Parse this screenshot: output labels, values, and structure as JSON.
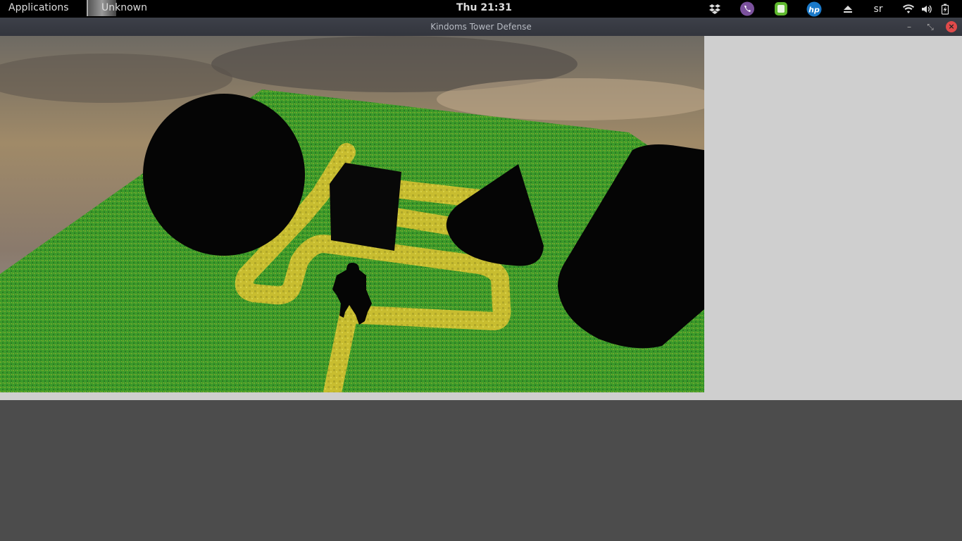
{
  "topbar": {
    "applications_label": "Applications",
    "unknown_label": "Unknown",
    "clock": "Thu 21:31",
    "user": "sr"
  },
  "window": {
    "title": "Kindoms Tower Defense",
    "minimize_glyph": "–",
    "restore_glyph": "⤡",
    "close_glyph": "×"
  },
  "icons": [
    "dropbox-icon",
    "viber-icon",
    "evernote-icon",
    "hp-icon",
    "eject-icon",
    "wifi-icon",
    "volume-icon",
    "battery-icon"
  ],
  "colors": {
    "grass": "#3e9a2c",
    "path": "#c9c033",
    "object": "#050505",
    "titlebar": "#3a3c44",
    "close": "#e04a4a"
  }
}
